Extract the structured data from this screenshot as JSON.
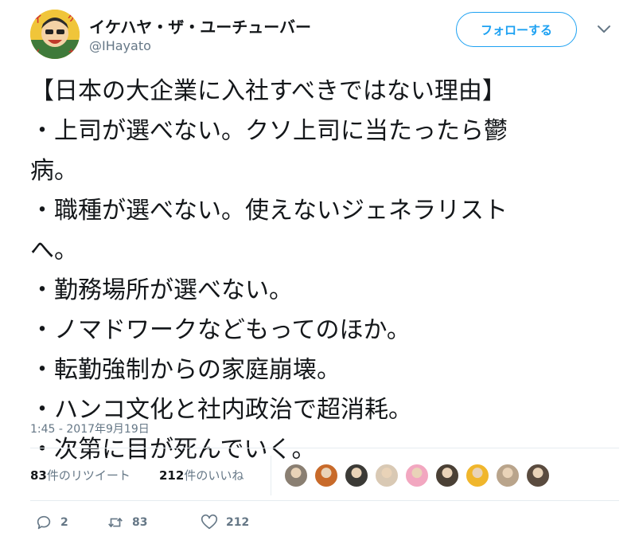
{
  "user": {
    "name": "イケハヤ・ザ・ユーチューバー",
    "handle": "@IHayato",
    "follow_label": "フォローする",
    "avatar_icon": "manga-face-avatar"
  },
  "tweet": {
    "lines": [
      "【日本の大企業に入社すべきではない理由】",
      "・上司が選べない。クソ上司に当たったら鬱",
      "病。",
      "・職種が選べない。使えないジェネラリスト",
      "へ。",
      "・勤務場所が選べない。",
      "・ノマドワークなどもってのほか。",
      "・転勤強制からの家庭崩壊。",
      "・ハンコ文化と社内政治で超消耗。",
      "・次第に目が死んでいく。"
    ],
    "timestamp": "1:45 - 2017年9月19日"
  },
  "stats": {
    "retweets_count": "83",
    "retweets_label": "件のリツイート",
    "likes_count": "212",
    "likes_label": "件のいいね",
    "liker_avatars": [
      "#8a7f72",
      "#c86a2a",
      "#3b3a36",
      "#d9c9b4",
      "#f2a7c0",
      "#4a4035",
      "#f0b62c",
      "#b9a48b",
      "#5a4b3f"
    ]
  },
  "actions": {
    "reply_count": "2",
    "retweet_count": "83",
    "like_count": "212"
  },
  "colors": {
    "accent": "#1da1f2",
    "muted": "#657786",
    "text": "#14171a"
  }
}
